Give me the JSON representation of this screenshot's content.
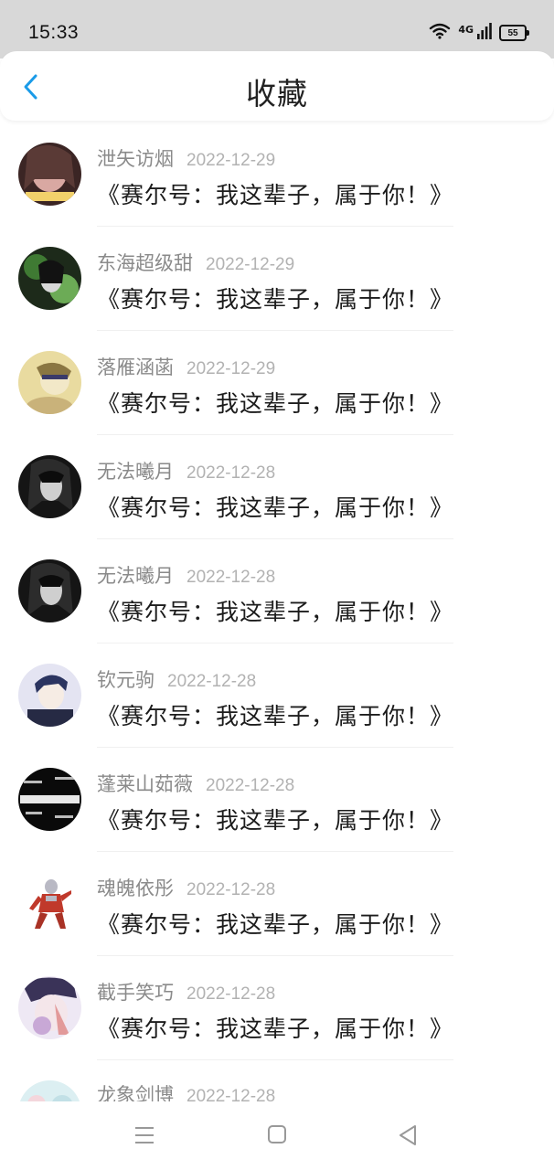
{
  "status": {
    "time": "15:33",
    "network": "4G",
    "battery": "55"
  },
  "header": {
    "title": "收藏"
  },
  "items": [
    {
      "name": "泄矢访烟",
      "date": "2022-12-29",
      "title": "《赛尔号：我这辈子，属于你！》",
      "avatar_colors": [
        "#c98a8a",
        "#3b2524"
      ]
    },
    {
      "name": "东海超级甜",
      "date": "2022-12-29",
      "title": "《赛尔号：我这辈子，属于你！》",
      "avatar_colors": [
        "#5c9a4a",
        "#1d2a1a"
      ]
    },
    {
      "name": "落雁涵菡",
      "date": "2022-12-29",
      "title": "《赛尔号：我这辈子，属于你！》",
      "avatar_colors": [
        "#e6d48a",
        "#9b8a55"
      ]
    },
    {
      "name": "无法曦月",
      "date": "2022-12-28",
      "title": "《赛尔号：我这辈子，属于你！》",
      "avatar_colors": [
        "#6a6a6a",
        "#111111"
      ]
    },
    {
      "name": "无法曦月",
      "date": "2022-12-28",
      "title": "《赛尔号：我这辈子，属于你！》",
      "avatar_colors": [
        "#6a6a6a",
        "#111111"
      ]
    },
    {
      "name": "钦元驹",
      "date": "2022-12-28",
      "title": "《赛尔号：我这辈子，属于你！》",
      "avatar_colors": [
        "#d8d8ec",
        "#2b3460"
      ]
    },
    {
      "name": "蓬莱山茹薇",
      "date": "2022-12-28",
      "title": "《赛尔号：我这辈子，属于你！》",
      "avatar_colors": [
        "#111111",
        "#eeeeee"
      ]
    },
    {
      "name": "魂魄依彤",
      "date": "2022-12-28",
      "title": "《赛尔号：我这辈子，属于你！》",
      "avatar_colors": [
        "#ffffff",
        "#c0392b"
      ]
    },
    {
      "name": "截手笑巧",
      "date": "2022-12-28",
      "title": "《赛尔号：我这辈子，属于你！》",
      "avatar_colors": [
        "#eae4f2",
        "#b890c8"
      ]
    },
    {
      "name": "龙象剑博",
      "date": "2022-12-28",
      "title": "",
      "avatar_colors": [
        "#d6eef0",
        "#9ec8cf"
      ]
    }
  ],
  "accent_color": "#1a9be8"
}
